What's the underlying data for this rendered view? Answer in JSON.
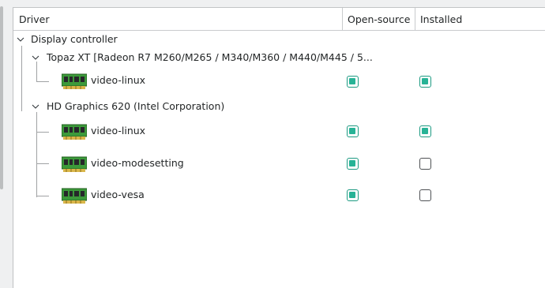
{
  "header": {
    "driver_label": "Driver",
    "opensource_label": "Open-source",
    "installed_label": "Installed"
  },
  "tree": {
    "category": "Display controller",
    "devices": [
      {
        "name": "Topaz XT [Radeon R7 M260/M265 / M340/M360 / M440/M445 / 5...",
        "drivers": [
          {
            "name": "video-linux",
            "open_source": true,
            "installed": true
          }
        ]
      },
      {
        "name": "HD Graphics 620 (Intel Corporation)",
        "drivers": [
          {
            "name": "video-linux",
            "open_source": true,
            "installed": true
          },
          {
            "name": "video-modesetting",
            "open_source": true,
            "installed": false
          },
          {
            "name": "video-vesa",
            "open_source": true,
            "installed": false
          }
        ]
      }
    ]
  },
  "icons": {
    "expander": "chevron-down-icon",
    "driver": "graphics-card-icon"
  },
  "colors": {
    "checkbox_accent": "#27b396",
    "checkbox_border": "#1d9a82"
  }
}
